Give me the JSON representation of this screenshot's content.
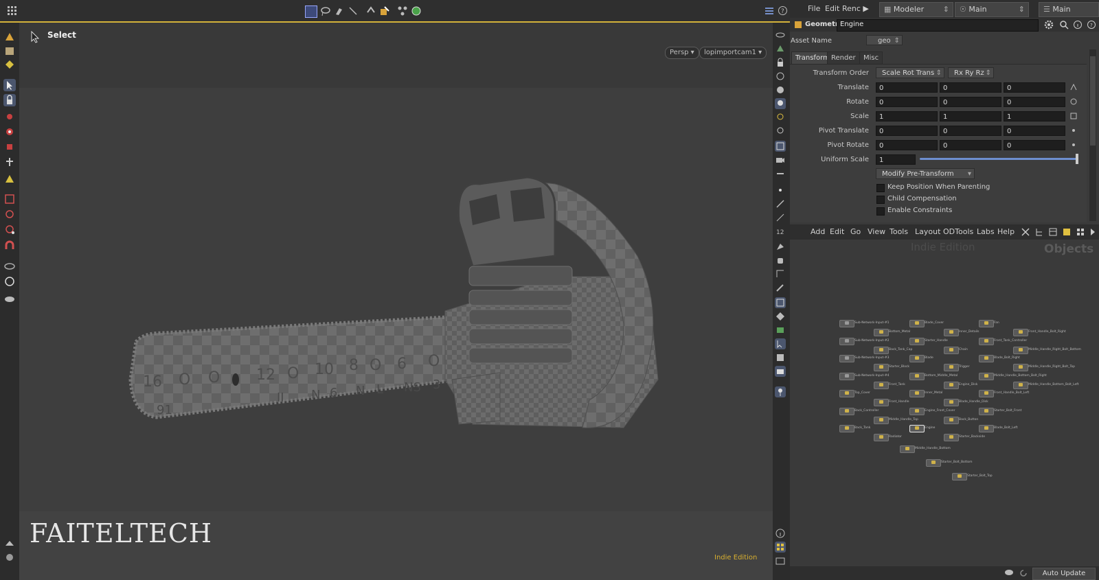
{
  "viewport": {
    "tool_label": "Select",
    "camera_view": "Persp ▾",
    "camera_name": "lopimportcam1 ▾",
    "watermark": "FAITELTECH",
    "edition_badge": "Indie Edition",
    "bar_numbers": [
      "16",
      "O",
      "O",
      "12",
      "O",
      "10",
      "8",
      "O",
      "6",
      "O"
    ],
    "bar_lower_numbers": [
      "91",
      "II",
      "N",
      "6",
      "N",
      "L",
      "NS",
      "3"
    ]
  },
  "colors": {
    "accent_yellow": "#d5b33a",
    "edition_text": "#d9b030",
    "node_color": "#cfb24a"
  },
  "menubar": {
    "items": [
      "File",
      "Edit",
      "Renc ▶"
    ],
    "desktop": "Modeler",
    "desktop_right": "Main",
    "pane_tab": "Main"
  },
  "params": {
    "type_label": "Geometry",
    "node_name": "Engine",
    "asset_name_label": "Asset Name",
    "asset_name_value": "geo",
    "tabs": [
      "Transform",
      "Render",
      "Misc"
    ],
    "transform_order_label": "Transform Order",
    "transform_order_value": "Scale Rot Trans",
    "rotate_order_value": "Rx Ry Rz",
    "rows": [
      {
        "label": "Translate",
        "values": [
          "0",
          "0",
          "0"
        ]
      },
      {
        "label": "Rotate",
        "values": [
          "0",
          "0",
          "0"
        ]
      },
      {
        "label": "Scale",
        "values": [
          "1",
          "1",
          "1"
        ]
      },
      {
        "label": "Pivot Translate",
        "values": [
          "0",
          "0",
          "0"
        ]
      },
      {
        "label": "Pivot Rotate",
        "values": [
          "0",
          "0",
          "0"
        ]
      }
    ],
    "uniform_scale_label": "Uniform Scale",
    "uniform_scale_value": "1",
    "pre_transform_button": "Modify Pre-Transform",
    "checkboxes": [
      "Keep Position When Parenting",
      "Child Compensation",
      "Enable Constraints"
    ]
  },
  "network": {
    "menu": [
      "Add",
      "Edit",
      "Go",
      "View",
      "Tools",
      "Layout",
      "ODTools",
      "Labs",
      "Help"
    ],
    "watermark": "Indie Edition",
    "context_label": "Objects",
    "nodes": [
      "Sub-Network-Input-#1",
      "Sub-Network-Input-#2",
      "Sub-Network-Input-#3",
      "Sub-Network-Input-#4",
      "Top_Cover",
      "Back_Controller",
      "Back_Tank",
      "Bottom_Metal",
      "Back_Tank_Cap",
      "Starter_Block",
      "Front_Tank",
      "Front_Handle",
      "Middle_Handle_Top",
      "Radiator",
      "Blade_Cover",
      "Starter_Handle",
      "Blade",
      "Bottom_Middle_Metal",
      "Inner_Metal",
      "Engine_Front_Cover",
      "Engine",
      "Inner_Details",
      "Chain",
      "Trigger",
      "Engine_Disk",
      "Blade_Handle_Disk",
      "Back_Button",
      "Starter_Backside",
      "Fan",
      "Front_Tank_Controller",
      "Blade_Bolt_Right",
      "Middle_Handle_Bottom_Bolt_Right",
      "Front_Handle_Bolt_Left",
      "Starter_Bolt_Front",
      "Blade_Bolt_Left",
      "Front_Handle_Bolt_Right",
      "Middle_Handle_Right_Bolt_Bottom",
      "Middle_Handle_Right_Bolt_Top",
      "Middle_Handle_Bottom_Bolt_Left",
      "Middle_Handle_Bottom",
      "Starter_Bolt_Bottom",
      "Starter_Bolt_Top"
    ]
  },
  "statusbar": {
    "auto_update": "Auto Update"
  }
}
